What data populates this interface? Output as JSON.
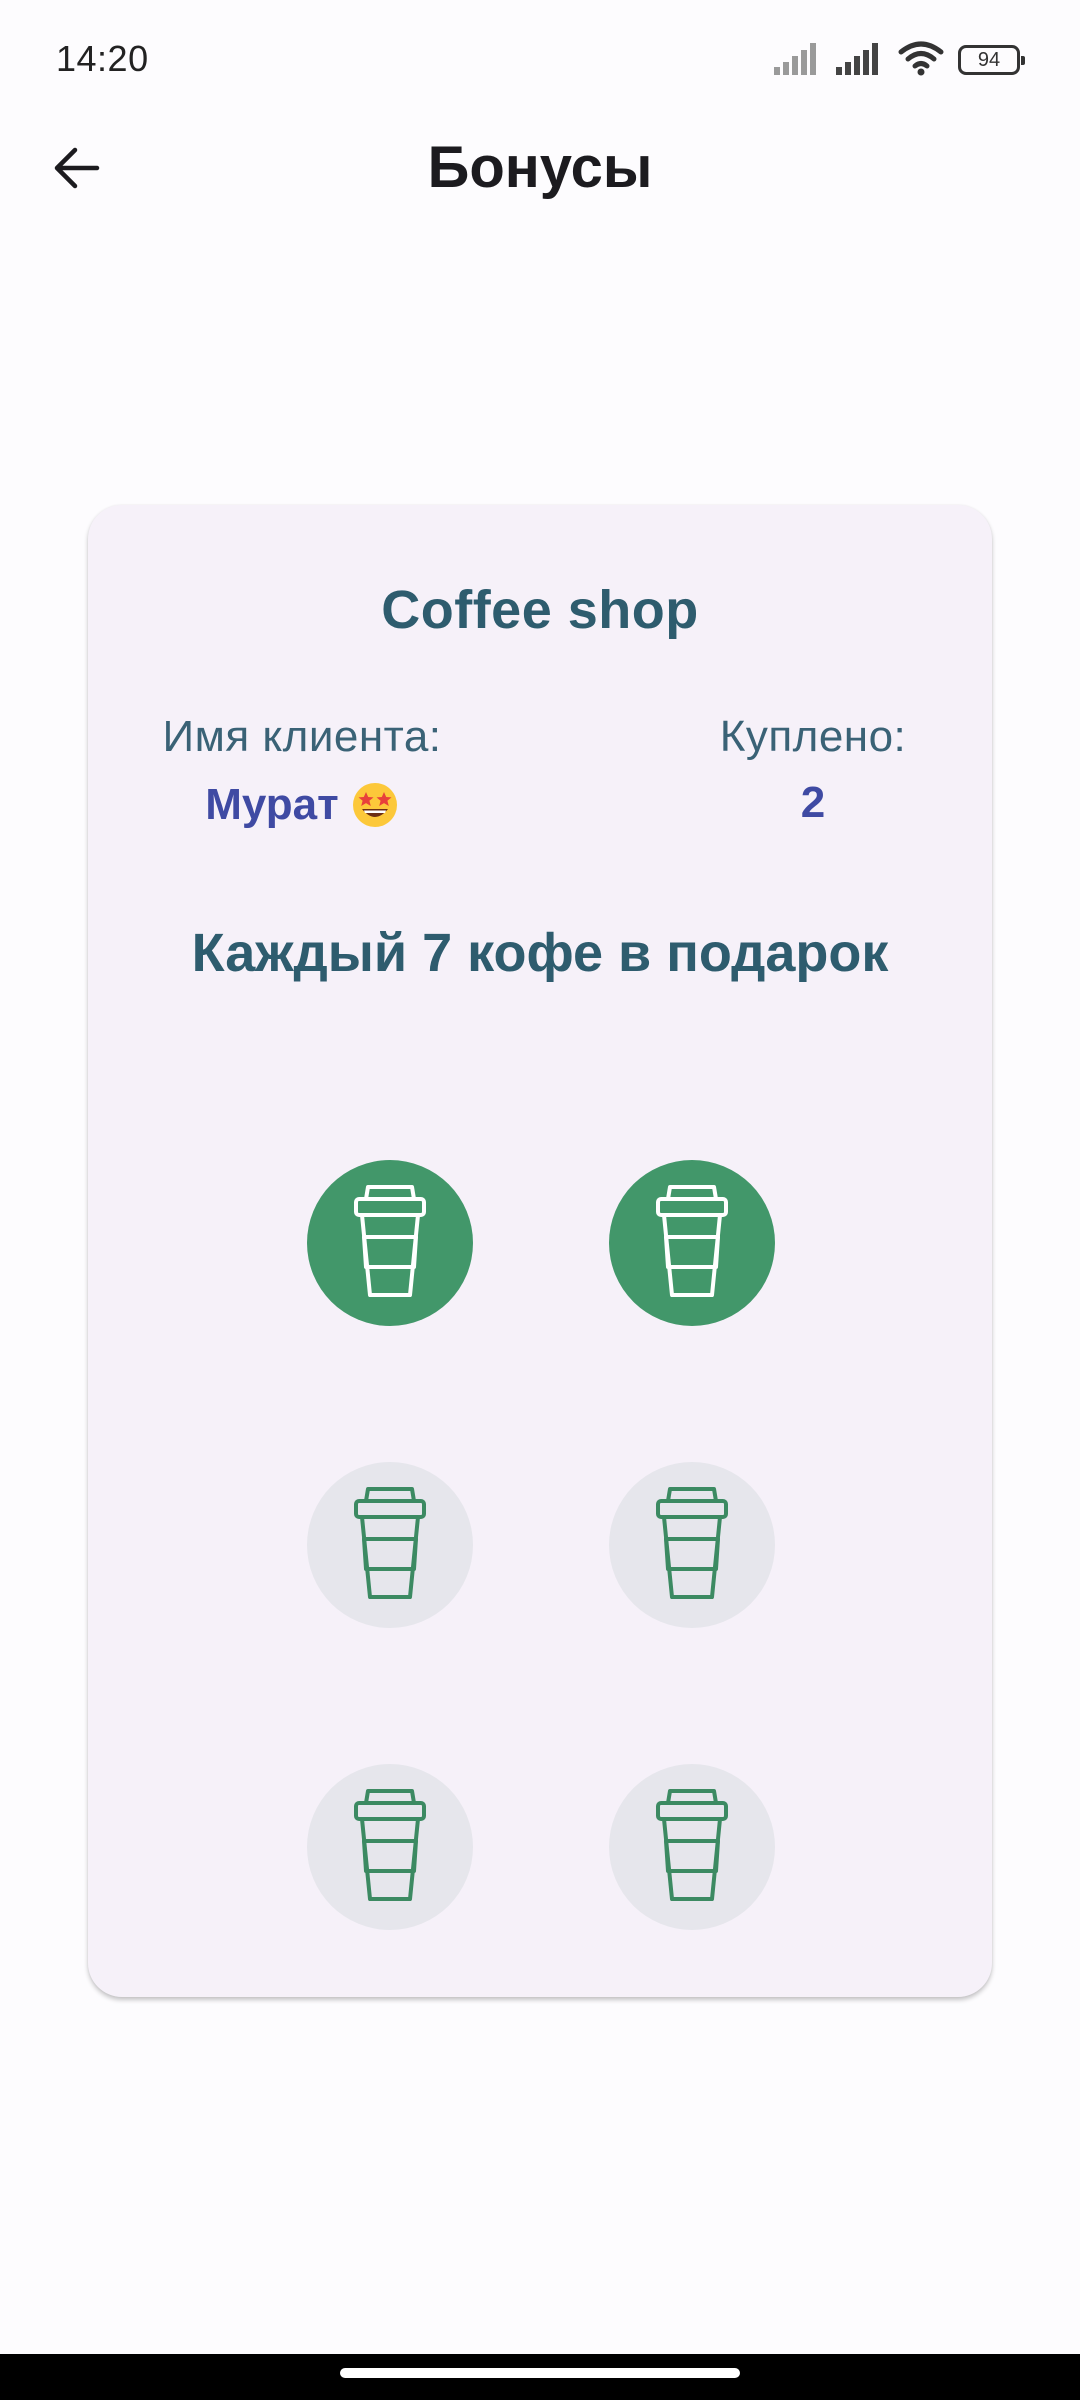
{
  "status_bar": {
    "time": "14:20",
    "battery": "94",
    "icons": [
      "cellular-signal-icon",
      "cellular-signal-icon",
      "wifi-icon",
      "battery-icon"
    ]
  },
  "header": {
    "title": "Бонусы",
    "back_icon": "arrow-left-icon"
  },
  "card": {
    "shop_name": "Coffee shop",
    "client_label": "Имя клиента:",
    "client_name": "Мурат",
    "client_emoji": "star-struck-emoji",
    "purchased_label": "Куплено:",
    "purchased_count": "2",
    "promo": "Каждый 7 кофе в подарок",
    "cups": [
      {
        "state": "filled"
      },
      {
        "state": "filled"
      },
      {
        "state": "empty"
      },
      {
        "state": "empty"
      },
      {
        "state": "empty"
      },
      {
        "state": "empty"
      }
    ]
  },
  "colors": {
    "accent_text": "#2e5c6e",
    "value_text": "#3f4aa3",
    "cup_filled": "#42976a",
    "cup_empty": "#e6e6ec",
    "card_bg": "#f6f1f9"
  }
}
